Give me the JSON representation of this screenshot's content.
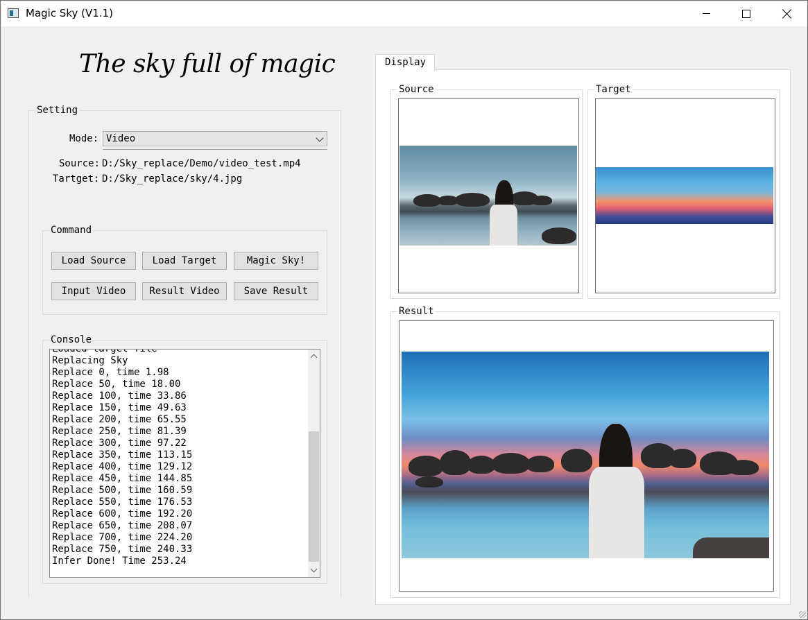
{
  "window": {
    "title": "Magic Sky (V1.1)"
  },
  "headline": "The sky full of magic",
  "setting": {
    "title": "Setting",
    "mode_label": "Mode:",
    "mode_value": "Video",
    "source_label": "Source:",
    "source_value": "D:/Sky_replace/Demo/video_test.mp4",
    "target_label": "Tartget:",
    "target_value": "D:/Sky_replace/sky/4.jpg"
  },
  "command": {
    "title": "Command",
    "load_source": "Load Source",
    "load_target": "Load Target",
    "magic_sky": "Magic Sky!",
    "input_video": "Input Video",
    "result_video": "Result Video",
    "save_result": "Save Result"
  },
  "console": {
    "title": "Console",
    "lines": [
      "Loaded target file",
      "Replacing Sky",
      "Replace 0, time 1.98",
      "Replace 50, time 18.00",
      "Replace 100, time 33.86",
      "Replace 150, time 49.63",
      "Replace 200, time 65.55",
      "Replace 250, time 81.39",
      "Replace 300, time 97.22",
      "Replace 350, time 113.15",
      "Replace 400, time 129.12",
      "Replace 450, time 144.85",
      "Replace 500, time 160.59",
      "Replace 550, time 176.53",
      "Replace 600, time 192.20",
      "Replace 650, time 208.07",
      "Replace 700, time 224.20",
      "Replace 750, time 240.33",
      "Infer Done! Time 253.24"
    ]
  },
  "display": {
    "tab": "Display",
    "source_title": "Source",
    "target_title": "Target",
    "result_title": "Result"
  },
  "icons": {
    "app": "app-icon",
    "minimize": "minimize-icon",
    "maximize": "maximize-icon",
    "close": "close-icon",
    "dropdown": "chevron-down-icon",
    "scroll_up": "chevron-up-icon",
    "scroll_down": "chevron-down-icon"
  }
}
